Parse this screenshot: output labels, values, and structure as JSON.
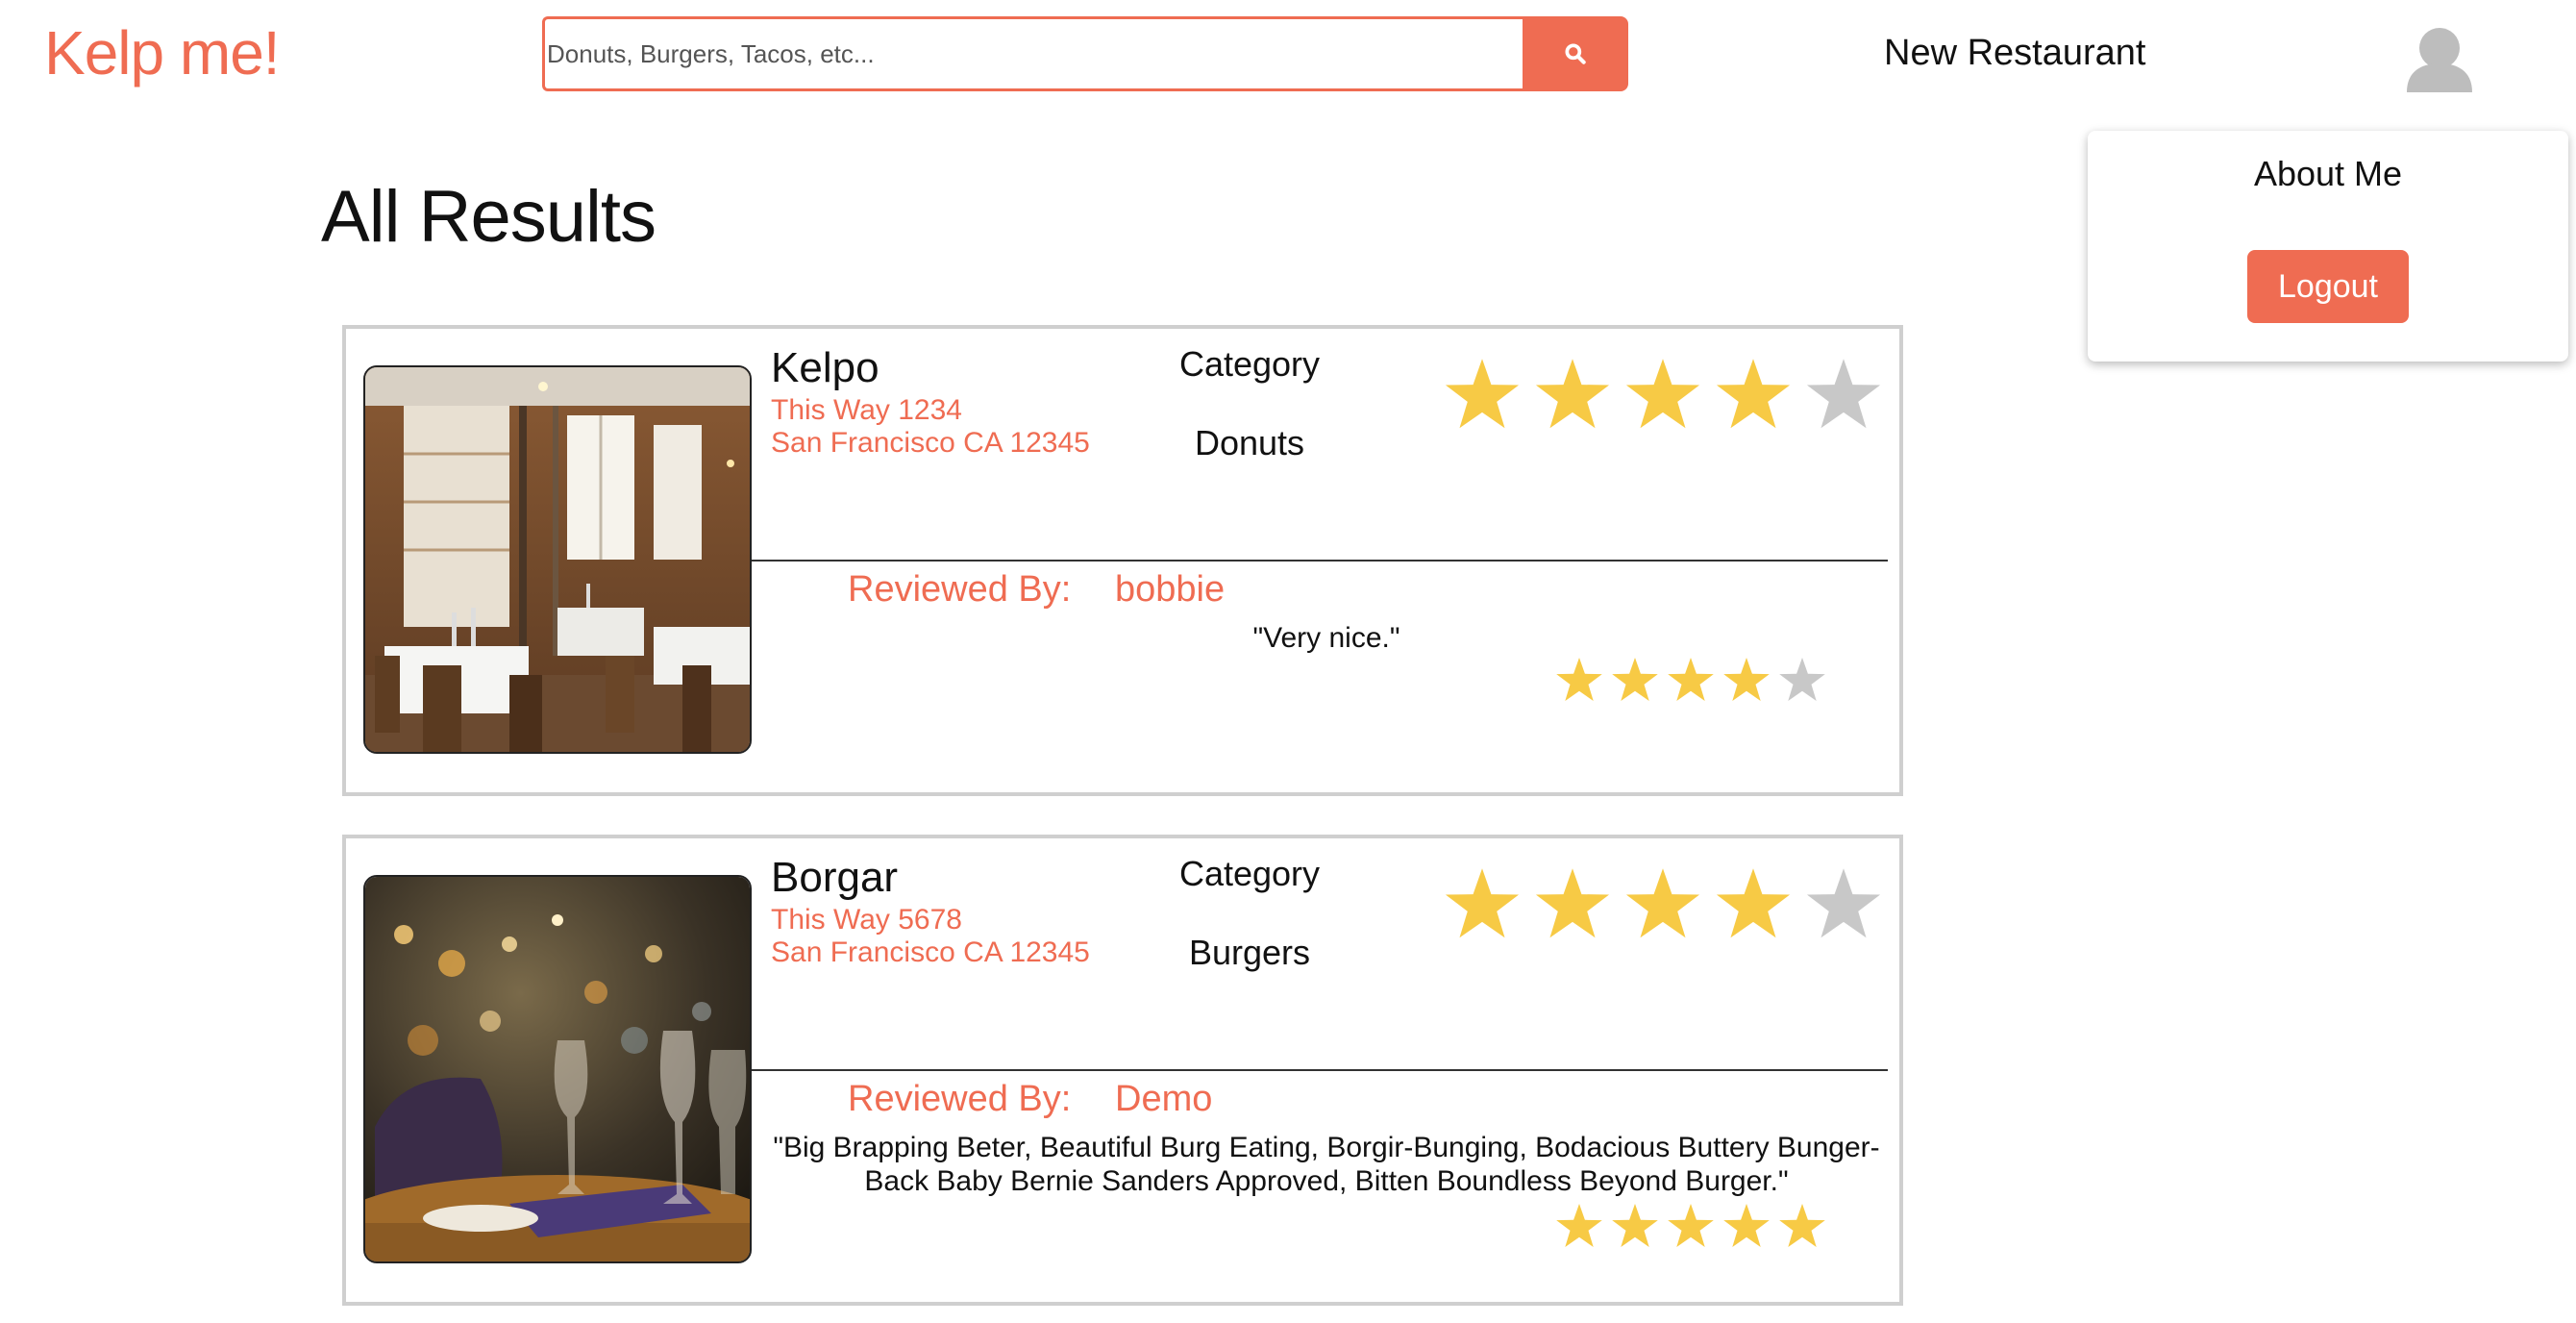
{
  "header": {
    "logo": "Kelp me!",
    "search_placeholder": "Donuts, Burgers, Tacos, etc...",
    "new_restaurant": "New Restaurant"
  },
  "dropdown": {
    "about": "About Me",
    "logout": "Logout"
  },
  "page_title": "All Results",
  "colors": {
    "accent": "#ef6c52",
    "star_filled": "#f7ca45",
    "star_empty": "#c8c8c8"
  },
  "restaurants": [
    {
      "name": "Kelpo",
      "address_line1": "This Way 1234",
      "address_line2": "San Francisco CA 12345",
      "category_heading": "Category",
      "category": "Donuts",
      "rating": 4,
      "review": {
        "label": "Reviewed By:",
        "user": "bobbie",
        "text": "\"Very nice.\"",
        "rating": 4
      }
    },
    {
      "name": "Borgar",
      "address_line1": "This Way 5678",
      "address_line2": "San Francisco CA 12345",
      "category_heading": "Category",
      "category": "Burgers",
      "rating": 4,
      "review": {
        "label": "Reviewed By:",
        "user": "Demo",
        "text": "\"Big Brapping Beter, Beautiful Burg Eating, Borgir-Bunging, Bodacious Buttery Bunger-Back Baby Bernie Sanders Approved, Bitten Boundless Beyond Burger.\"",
        "rating": 5
      }
    }
  ]
}
